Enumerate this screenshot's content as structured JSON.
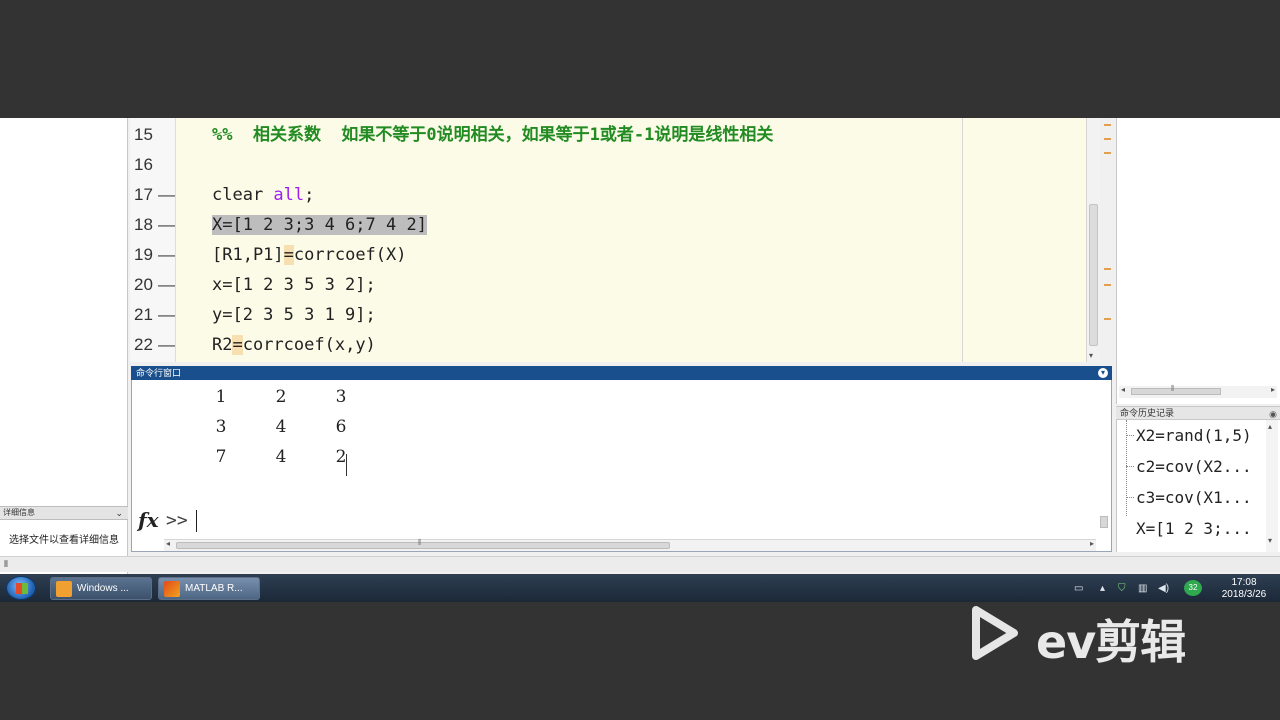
{
  "editor": {
    "lines": [
      {
        "num": "15",
        "dash": "",
        "segments": [
          {
            "t": "%%  相关系数  如果不等于0说明相关，如果等于1或者-1说明是线性相关",
            "c": "green"
          }
        ]
      },
      {
        "num": "16",
        "dash": "",
        "segments": []
      },
      {
        "num": "17",
        "dash": "—",
        "segments": [
          {
            "t": "clear ",
            "c": ""
          },
          {
            "t": "all",
            "c": "purple"
          },
          {
            "t": ";",
            "c": ""
          }
        ]
      },
      {
        "num": "18",
        "dash": "—",
        "segments": [
          {
            "t": "X=[1 2 3;3 4 6;7 4 2]",
            "c": "sel"
          }
        ]
      },
      {
        "num": "19",
        "dash": "—",
        "segments": [
          {
            "t": "[R1,P1]",
            "c": ""
          },
          {
            "t": "=",
            "c": "hl"
          },
          {
            "t": "corrcoef(X)",
            "c": ""
          }
        ]
      },
      {
        "num": "20",
        "dash": "—",
        "segments": [
          {
            "t": "x=[1 2 3 5 3 2];",
            "c": ""
          }
        ]
      },
      {
        "num": "21",
        "dash": "—",
        "segments": [
          {
            "t": "y=[2 3 5 3 1 9];",
            "c": ""
          }
        ]
      },
      {
        "num": "22",
        "dash": "—",
        "segments": [
          {
            "t": "R2",
            "c": ""
          },
          {
            "t": "=",
            "c": "hl"
          },
          {
            "t": "corrcoef(x,y)",
            "c": ""
          }
        ]
      }
    ]
  },
  "command_window": {
    "title": "命令行窗口",
    "output_rows": [
      [
        "1",
        "2",
        "3"
      ],
      [
        "3",
        "4",
        "6"
      ],
      [
        "7",
        "4",
        "2"
      ]
    ],
    "fx_label": "fx",
    "prompt": ">>"
  },
  "details": {
    "header": "详细信息",
    "text": "选择文件以查看详细信息"
  },
  "history": {
    "header": "命令历史记录",
    "items": [
      "X2=rand(1,5)",
      "c2=cov(X2...",
      "c3=cov(X1...",
      "X=[1 2 3;..."
    ]
  },
  "taskbar": {
    "buttons": [
      "Windows ...",
      "MATLAB R..."
    ],
    "badge": "32",
    "time": "17:08",
    "date": "2018/3/26"
  },
  "watermark": {
    "text": "ev剪辑"
  },
  "colors": {
    "editor_bg": "#fbfbe8",
    "comment_green": "#228b22",
    "keyword_purple": "#a020f0",
    "selection_gray": "#bdbdbd",
    "title_blue": "#1a4f8e"
  }
}
